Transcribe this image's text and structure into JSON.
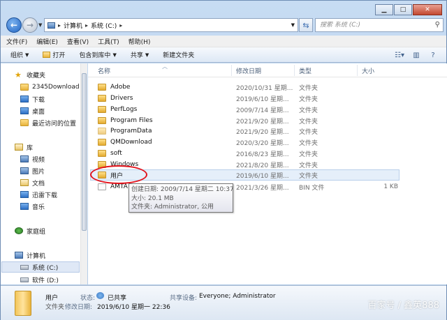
{
  "window": {
    "minimize_glyph": "▁",
    "maximize_glyph": "□",
    "close_glyph": "✕"
  },
  "address": {
    "segments": [
      "计算机",
      "系统 (C:)"
    ],
    "separator": "▸"
  },
  "search": {
    "placeholder": "搜索 系统 (C:)"
  },
  "menubar": [
    "文件(F)",
    "编辑(E)",
    "查看(V)",
    "工具(T)",
    "帮助(H)"
  ],
  "toolbar": {
    "organize": "组织",
    "open": "打开",
    "include_in_library": "包含到库中",
    "share": "共享",
    "new_folder": "新建文件夹"
  },
  "navpane": {
    "favorites": "收藏夹",
    "fav_items": [
      "2345Download",
      "下载",
      "桌面",
      "最近访问的位置"
    ],
    "libraries": "库",
    "lib_items": [
      "视频",
      "图片",
      "文档",
      "迅雷下载",
      "音乐"
    ],
    "homegroup": "家庭组",
    "computer": "计算机",
    "drives": [
      "系统 (C:)",
      "软件 (D:)"
    ]
  },
  "columns": {
    "name": "名称",
    "modified": "修改日期",
    "type": "类型",
    "size": "大小"
  },
  "files": [
    {
      "name": "Adobe",
      "modified": "2020/10/31 星期...",
      "type": "文件夹",
      "size": "",
      "icon": "folder"
    },
    {
      "name": "Drivers",
      "modified": "2019/6/10 星期...",
      "type": "文件夹",
      "size": "",
      "icon": "folder"
    },
    {
      "name": "PerfLogs",
      "modified": "2009/7/14 星期...",
      "type": "文件夹",
      "size": "",
      "icon": "folder"
    },
    {
      "name": "Program Files",
      "modified": "2021/9/20 星期...",
      "type": "文件夹",
      "size": "",
      "icon": "folder"
    },
    {
      "name": "ProgramData",
      "modified": "2021/9/20 星期...",
      "type": "文件夹",
      "size": "",
      "icon": "folder"
    },
    {
      "name": "QMDownload",
      "modified": "2020/3/20 星期...",
      "type": "文件夹",
      "size": "",
      "icon": "folder"
    },
    {
      "name": "soft",
      "modified": "2016/8/23 星期...",
      "type": "文件夹",
      "size": "",
      "icon": "folder"
    },
    {
      "name": "Windows",
      "modified": "2021/8/20 星期...",
      "type": "文件夹",
      "size": "",
      "icon": "folder"
    },
    {
      "name": "用户",
      "modified": "2019/6/10 星期...",
      "type": "文件夹",
      "size": "",
      "icon": "folder"
    },
    {
      "name": "AMTA",
      "modified": "2021/3/26 星期...",
      "type": "BIN 文件",
      "size": "1 KB",
      "icon": "file"
    }
  ],
  "tooltip": {
    "created": "创建日期: 2009/7/14 星期二 10:37",
    "size": "大小: 20.1 MB",
    "folders": "文件夹: Administrator, 公用"
  },
  "details": {
    "name": "用户",
    "type_label": "文件夹",
    "status_label": "状态:",
    "status_value": "已共享",
    "shared_with_label": "共享设备:",
    "shared_with_value": "Everyone; Administrator",
    "modified_label": "修改日期:",
    "modified_value": "2019/6/10 星期一 22:36"
  },
  "watermark": "百家号 / 鑫英888",
  "colors": {
    "highlight_oval": "#e2121b",
    "selection": "#e5effa"
  }
}
